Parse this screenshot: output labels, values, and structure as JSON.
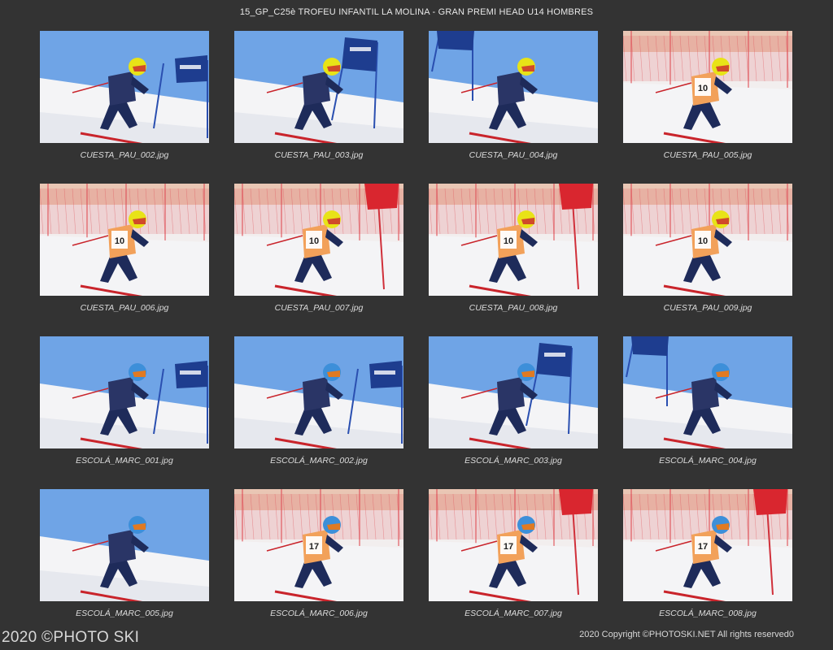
{
  "title": "15_GP_C25è TROFEU INFANTIL LA MOLINA - GRAN PREMI HEAD U14 HOMBRES",
  "footer": {
    "left": "2020 ©PHOTO SKI",
    "right": "2020 Copyright ©PHOTOSKI.NET All rights reserved",
    "page": "0"
  },
  "colors": {
    "background": "#333333",
    "sky": "#6fa4e6",
    "snow": "#f4f4f6",
    "gate_blue": "#1e3d8f",
    "fence_red": "#e0525a"
  },
  "photos": [
    {
      "caption": "CUESTA_PAU_002.jpg",
      "scene": "sky",
      "helmet": "yellow",
      "bib": "",
      "gate": "right"
    },
    {
      "caption": "CUESTA_PAU_003.jpg",
      "scene": "sky",
      "helmet": "yellow",
      "bib": "",
      "gate": "top"
    },
    {
      "caption": "CUESTA_PAU_004.jpg",
      "scene": "sky",
      "helmet": "yellow",
      "bib": "",
      "gate": "topleft"
    },
    {
      "caption": "CUESTA_PAU_005.jpg",
      "scene": "fence",
      "helmet": "yellow",
      "bib": "10",
      "gate": "none"
    },
    {
      "caption": "CUESTA_PAU_006.jpg",
      "scene": "fence",
      "helmet": "yellow",
      "bib": "10",
      "gate": "none"
    },
    {
      "caption": "CUESTA_PAU_007.jpg",
      "scene": "fence",
      "helmet": "yellow",
      "bib": "10",
      "gate": "red"
    },
    {
      "caption": "CUESTA_PAU_008.jpg",
      "scene": "fence",
      "helmet": "yellow",
      "bib": "10",
      "gate": "red"
    },
    {
      "caption": "CUESTA_PAU_009.jpg",
      "scene": "fence",
      "helmet": "yellow",
      "bib": "10",
      "gate": "none"
    },
    {
      "caption": "ESCOLÁ_MARC_001.jpg",
      "scene": "sky",
      "helmet": "blue",
      "bib": "",
      "gate": "right"
    },
    {
      "caption": "ESCOLÁ_MARC_002.jpg",
      "scene": "sky",
      "helmet": "blue",
      "bib": "",
      "gate": "right"
    },
    {
      "caption": "ESCOLÁ_MARC_003.jpg",
      "scene": "sky",
      "helmet": "blue",
      "bib": "",
      "gate": "top"
    },
    {
      "caption": "ESCOLÁ_MARC_004.jpg",
      "scene": "sky",
      "helmet": "blue",
      "bib": "",
      "gate": "topleft"
    },
    {
      "caption": "ESCOLÁ_MARC_005.jpg",
      "scene": "sky",
      "helmet": "blue",
      "bib": "",
      "gate": "none"
    },
    {
      "caption": "ESCOLÁ_MARC_006.jpg",
      "scene": "fence",
      "helmet": "blue",
      "bib": "17",
      "gate": "none"
    },
    {
      "caption": "ESCOLÁ_MARC_007.jpg",
      "scene": "fence",
      "helmet": "blue",
      "bib": "17",
      "gate": "red"
    },
    {
      "caption": "ESCOLÁ_MARC_008.jpg",
      "scene": "fence",
      "helmet": "blue",
      "bib": "17",
      "gate": "red"
    }
  ]
}
